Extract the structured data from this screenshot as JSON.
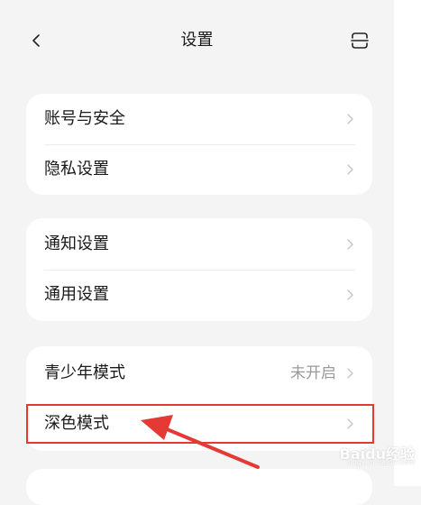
{
  "header": {
    "title": "设置",
    "back_icon": "chevron-left-icon",
    "scan_icon": "scan-icon"
  },
  "groups": [
    {
      "items": [
        {
          "label": "账号与安全"
        },
        {
          "label": "隐私设置"
        }
      ]
    },
    {
      "items": [
        {
          "label": "通知设置"
        },
        {
          "label": "通用设置"
        }
      ]
    },
    {
      "items": [
        {
          "label": "青少年模式",
          "value": "未开启"
        },
        {
          "label": "深色模式"
        }
      ]
    }
  ],
  "annotation": {
    "highlight_color": "#e53935",
    "highlighted_item": "深色模式"
  },
  "watermark": {
    "text": "Baidu经验",
    "sub": "jingyan.baidu.com"
  }
}
